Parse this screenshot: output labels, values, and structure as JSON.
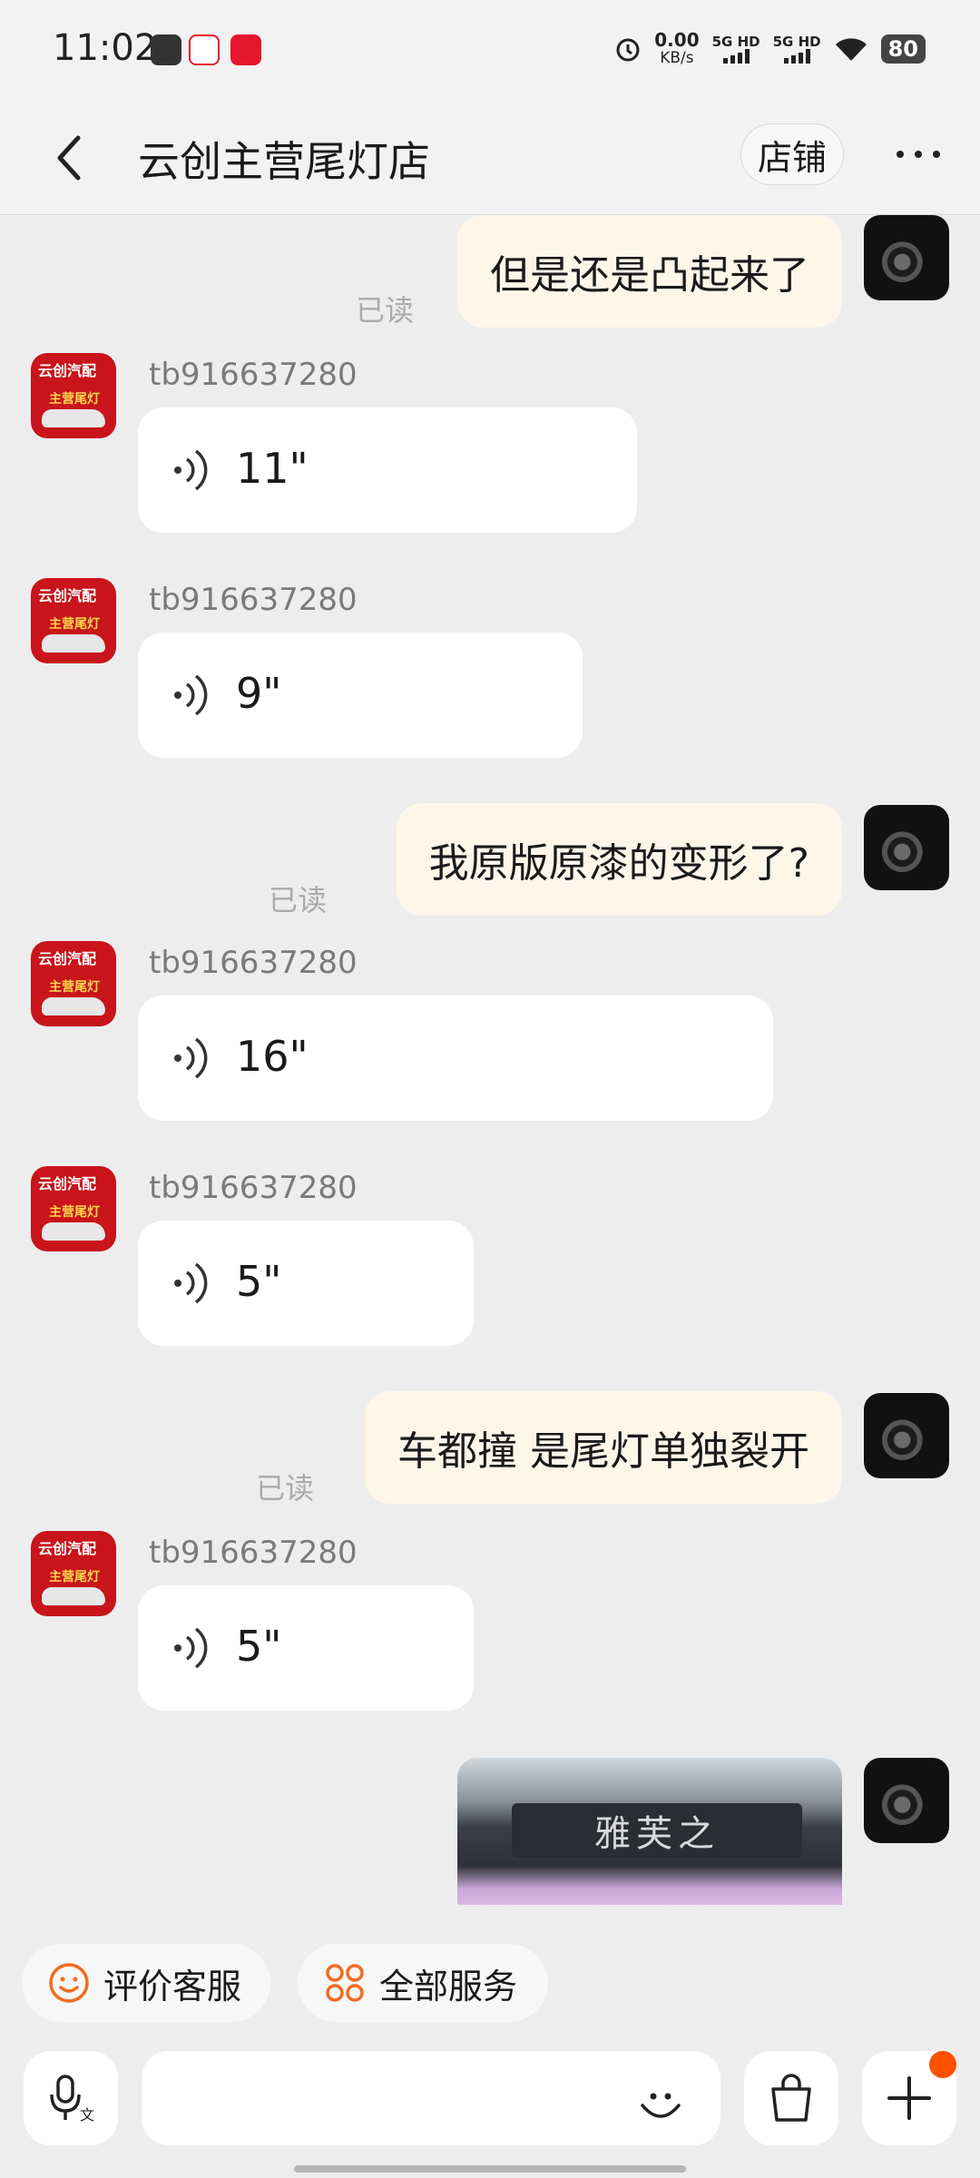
{
  "status_bar": {
    "time": "11:02",
    "net_speed": "0.00",
    "net_unit": "KB/s",
    "sim1": "5G HD",
    "sim2": "5G HD",
    "battery": "80"
  },
  "header": {
    "title": "云创主营尾灯店",
    "shop_button": "店铺"
  },
  "messages": {
    "m1": {
      "text": "但是还是凸起来了",
      "read": "已读"
    },
    "m2": {
      "username": "tb916637280",
      "duration": "11\""
    },
    "m3": {
      "username": "tb916637280",
      "duration": "9\""
    },
    "m4": {
      "text": "我原版原漆的变形了?",
      "read": "已读"
    },
    "m5": {
      "username": "tb916637280",
      "duration": "16\""
    },
    "m6": {
      "username": "tb916637280",
      "duration": "5\""
    },
    "m7": {
      "text": "车都撞 是尾灯单独裂开",
      "read": "已读"
    },
    "m8": {
      "username": "tb916637280",
      "duration": "5\""
    },
    "m9": {
      "image_text": "雅芙之"
    }
  },
  "shop_avatar": {
    "line1": "云创汽配",
    "line2": "主营尾灯"
  },
  "quick_actions": {
    "rate": "评价客服",
    "services": "全部服务"
  },
  "input": {
    "placeholder": ""
  },
  "colors": {
    "accent": "#ff5000",
    "bubble_me": "#fdf6e9",
    "background": "#ededed"
  }
}
